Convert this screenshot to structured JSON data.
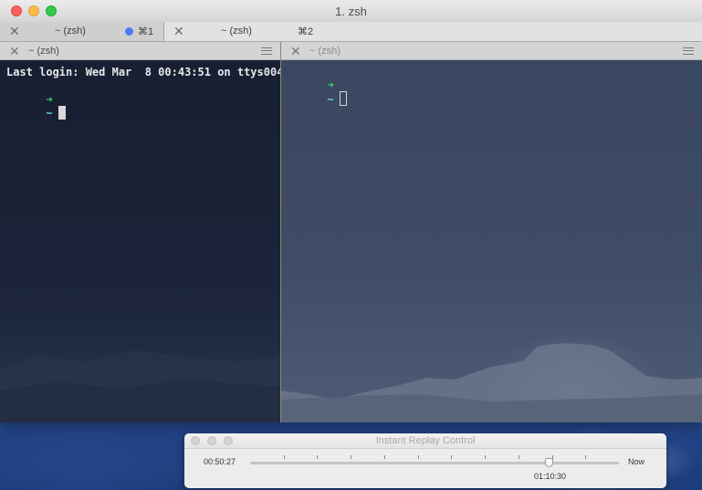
{
  "window": {
    "title": "1. zsh"
  },
  "tabs": [
    {
      "label": "~ (zsh)",
      "shortcut": "⌘1",
      "active": false,
      "activity_dot_color": "#4f78f4"
    },
    {
      "label": "~ (zsh)",
      "shortcut": "⌘2",
      "active": true
    }
  ],
  "panes": [
    {
      "header": "~ (zsh)",
      "lines": {
        "login": "Last login: Wed Mar  8 00:43:51 on ttys004",
        "prompt_arrow": "➜",
        "prompt_dir": "~"
      }
    },
    {
      "header": "~ (zsh)",
      "lines": {
        "prompt_arrow": "➜",
        "prompt_dir": "~"
      }
    }
  ],
  "instant_replay": {
    "title": "Instant Replay Control",
    "start_time": "00:50:27",
    "end_label": "Now",
    "current_time": "01:10:30",
    "position_fraction": 0.81
  },
  "colors": {
    "prompt_arrow": "#3ad36f",
    "prompt_dir": "#5fd7e0",
    "close": "#fc605c",
    "minimize": "#fdbc40",
    "maximize": "#34c84a"
  }
}
